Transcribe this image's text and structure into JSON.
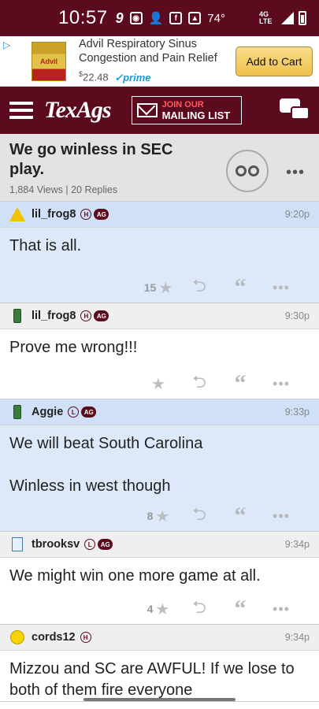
{
  "status_bar": {
    "time": "10:57",
    "temperature": "74°",
    "network": "4G LTE",
    "icons": [
      "nine-app-icon",
      "camera-icon",
      "add-contact-icon",
      "facebook-icon",
      "image-icon",
      "signal-icon",
      "battery-icon"
    ]
  },
  "ad": {
    "title": "Advil Respiratory Sinus Congestion and Pain Relief",
    "price_symbol": "$",
    "price": "22.48",
    "prime_label": "prime",
    "product_label": "Advil",
    "button_label": "Add to Cart"
  },
  "navbar": {
    "logo": "TexAgs",
    "mailing_top": "JOIN OUR",
    "mailing_bottom": "MAILING LIST"
  },
  "thread": {
    "title": "We go winless in SEC play.",
    "meta": "1,884 Views | 20 Replies"
  },
  "posts": [
    {
      "user": "lil_frog8",
      "badge": "H",
      "ag": "AG",
      "time": "9:20p",
      "text": "That is all.",
      "stars": "15"
    },
    {
      "user": "lil_frog8",
      "badge": "H",
      "ag": "AG",
      "time": "9:30p",
      "text": "Prove me wrong!!!",
      "stars": ""
    },
    {
      "user": "Aggie",
      "badge": "L",
      "ag": "AG",
      "time": "9:33p",
      "text": "We will beat South Carolina\n\nWinless in west though",
      "stars": "8"
    },
    {
      "user": "tbrooksv",
      "badge": "L",
      "ag": "AG",
      "time": "9:34p",
      "text": "We might win one more game at all.",
      "stars": "4"
    },
    {
      "user": "cords12",
      "badge": "H",
      "ag": "",
      "time": "9:34p",
      "text": "Mizzou and SC are AWFUL! If we lose to both of them fire everyone",
      "stars": ""
    }
  ],
  "colors": {
    "maroon": "#5c0a1e",
    "highlight_blue": "#dde9f9",
    "header_gray": "#e3e3e3"
  }
}
